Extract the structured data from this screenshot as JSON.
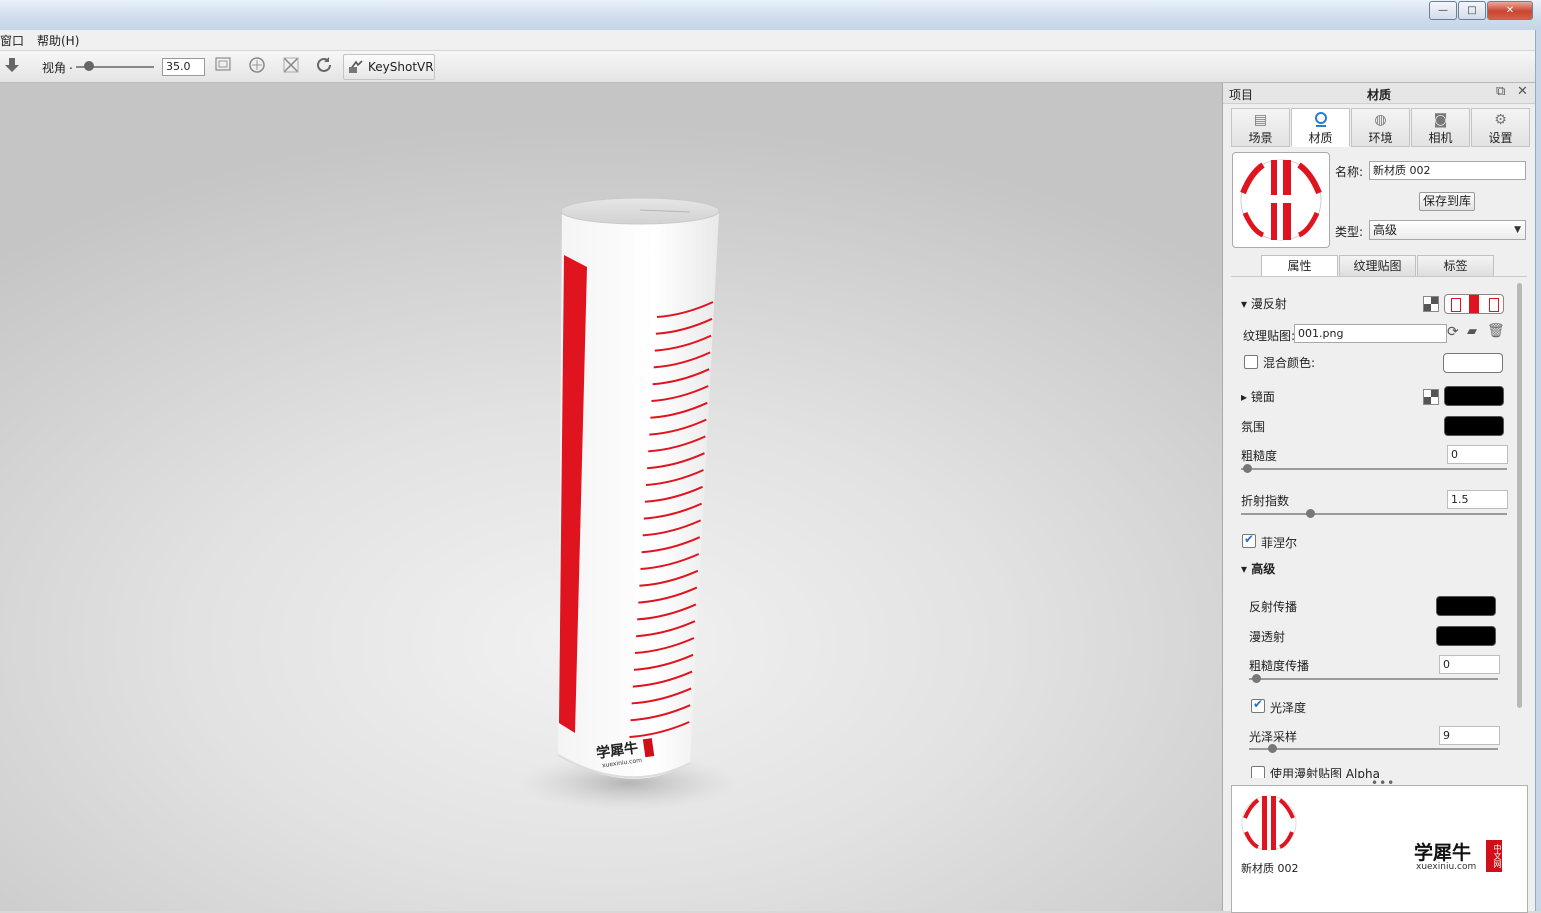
{
  "window": {
    "title": "",
    "buttons": {
      "minimize": "—",
      "maximize": "□",
      "close": "✕"
    }
  },
  "menu": {
    "items": [
      "窗口",
      "帮助(H)"
    ]
  },
  "toolbar": {
    "fov_label": "视角",
    "fov_value": "35.0",
    "keyshotvr_label": "KeyShotVR"
  },
  "panel": {
    "header_left": "项目",
    "header_title": "材质",
    "tabs": [
      {
        "label": "场景",
        "icon": "list-icon"
      },
      {
        "label": "材质",
        "icon": "material-icon"
      },
      {
        "label": "环境",
        "icon": "globe-icon"
      },
      {
        "label": "相机",
        "icon": "camera-icon"
      },
      {
        "label": "设置",
        "icon": "gear-icon"
      }
    ],
    "name_label": "名称:",
    "name_value": "新材质 002",
    "save_button": "保存到库",
    "type_label": "类型:",
    "type_value": "高级",
    "subtabs": [
      "属性",
      "纹理贴图",
      "标签"
    ],
    "props": {
      "diffuse_header": "漫反射",
      "texture_label": "纹理贴图:",
      "texture_value": "001.png",
      "blend_color_label": "混合颜色:",
      "specular_header": "镜面",
      "atmosphere_label": "氛围",
      "roughness_label": "粗糙度",
      "roughness_value": "0",
      "ior_label": "折射指数",
      "ior_value": "1.5",
      "fresnel_label": "菲涅尔",
      "advanced_header": "高级",
      "reflection_spread_label": "反射传播",
      "diffuse_transmission_label": "漫透射",
      "roughness_spread_label": "粗糙度传播",
      "roughness_spread_value": "0",
      "gloss_label": "光泽度",
      "gloss_samples_label": "光泽采样",
      "gloss_samples_value": "9",
      "cutoff_text": "使用漫射贴图 Alpha"
    },
    "library": {
      "item_label": "新材质 002",
      "watermark_main": "学犀牛",
      "watermark_badge": "中文网",
      "watermark_url": "xuexiniu.com"
    }
  },
  "model": {
    "watermark_text": "学犀牛",
    "watermark_url": "xuexiniu.com"
  },
  "colors": {
    "accent_red": "#e0141e",
    "check_blue": "#2b6fd0"
  }
}
